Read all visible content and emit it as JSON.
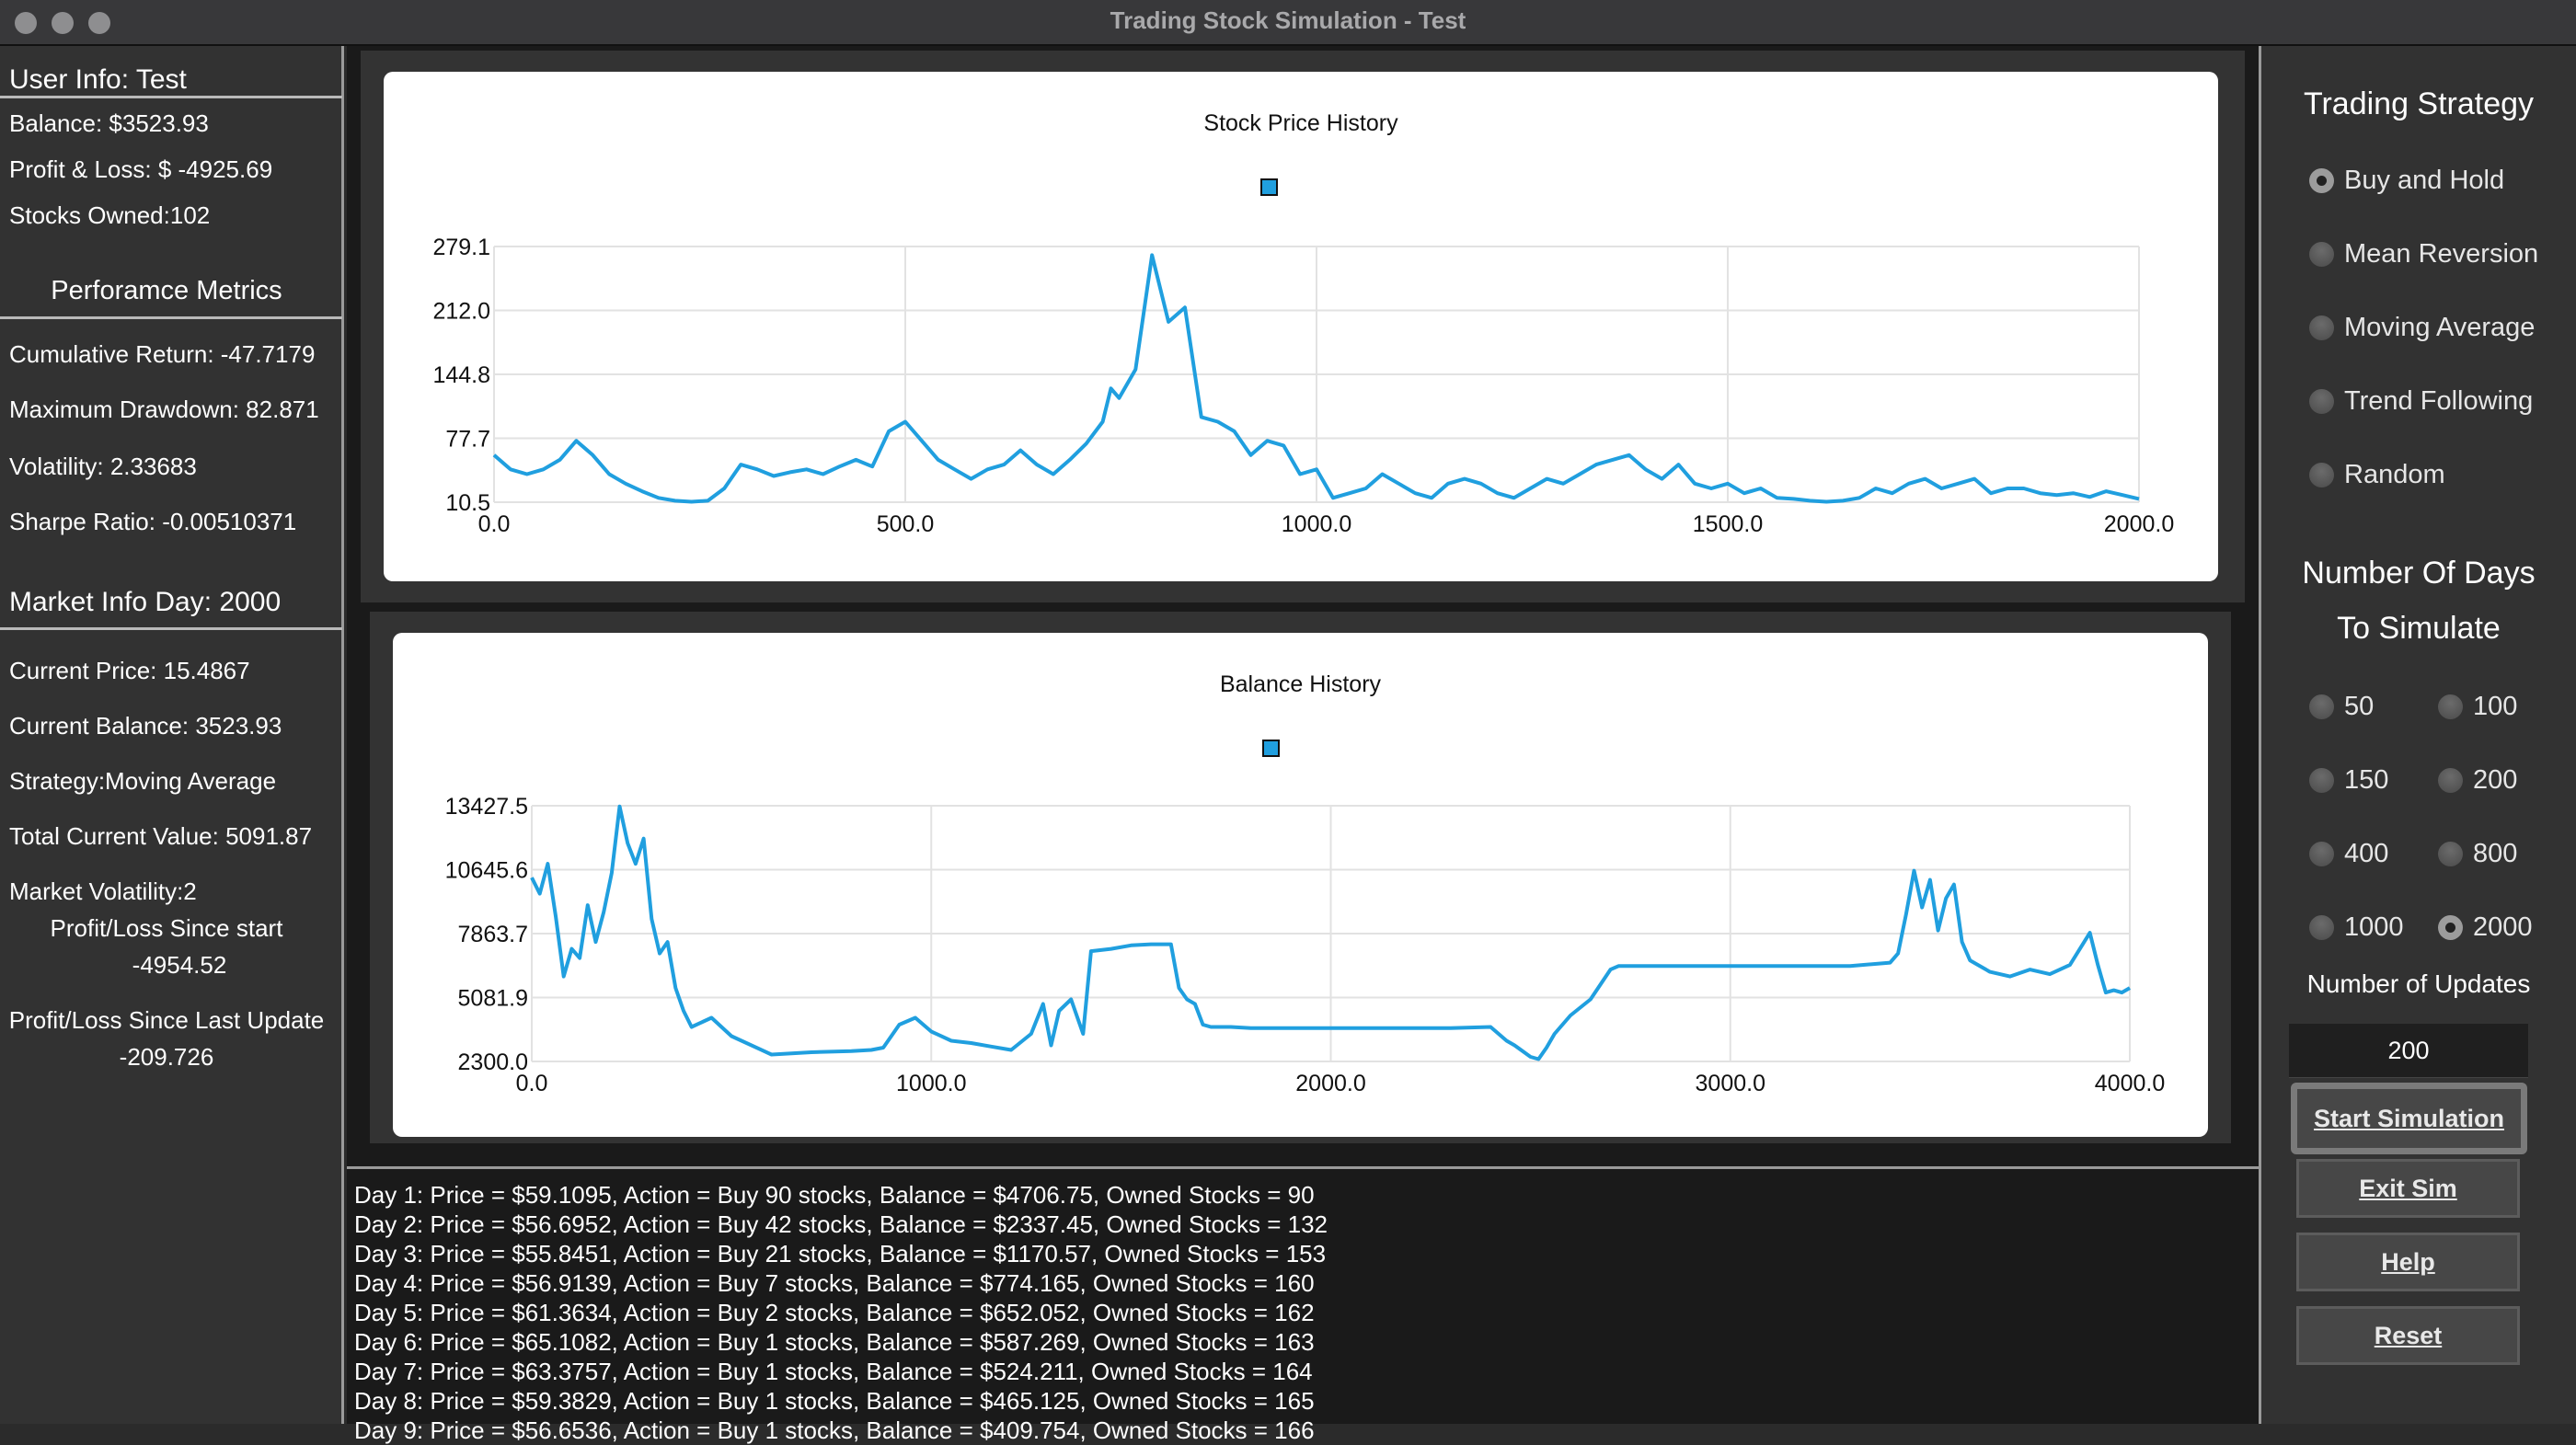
{
  "window": {
    "title": "Trading Stock Simulation - Test",
    "controls": [
      "close",
      "minimize",
      "zoom"
    ]
  },
  "user_info": {
    "heading": "User Info: Test",
    "balance": "Balance: $3523.93",
    "profit_loss": "Profit & Loss: $  -4925.69",
    "stocks_owned": "Stocks Owned:102"
  },
  "performance": {
    "heading": "Perforamce Metrics",
    "cumulative_return": "Cumulative Return: -47.7179",
    "max_drawdown": "Maximum Drawdown: 82.871",
    "volatility": "Volatility: 2.33683",
    "sharpe_ratio": "Sharpe Ratio: -0.00510371"
  },
  "market_info": {
    "heading": "Market Info Day: 2000",
    "current_price": "Current Price: 15.4867",
    "current_balance": "Current Balance:  3523.93",
    "strategy": "Strategy:Moving Average",
    "total_value": "Total Current Value: 5091.87",
    "market_volatility": "Market Volatility:2",
    "pl_since_start_label": "Profit/Loss Since start",
    "pl_since_start_value": "-4954.52",
    "pl_since_update_label": "Profit/Loss Since Last Update",
    "pl_since_update_value": "-209.726"
  },
  "chart_data": [
    {
      "type": "line",
      "title": "Stock Price History",
      "xlabel": "",
      "ylabel": "",
      "xlim": [
        0,
        2000
      ],
      "ylim": [
        10.5,
        279.1
      ],
      "x_ticks": [
        "0.0",
        "500.0",
        "1000.0",
        "1500.0",
        "2000.0"
      ],
      "y_ticks": [
        "10.5",
        "77.7",
        "144.8",
        "212.0",
        "279.1"
      ],
      "grid": true,
      "legend": "top-center",
      "series_color": "#209fdf",
      "series": [
        {
          "name": "",
          "x": [
            0,
            20,
            40,
            60,
            80,
            100,
            120,
            140,
            160,
            180,
            200,
            220,
            240,
            260,
            280,
            300,
            320,
            340,
            360,
            380,
            400,
            420,
            440,
            460,
            480,
            500,
            520,
            540,
            560,
            580,
            600,
            620,
            640,
            660,
            680,
            700,
            720,
            740,
            750,
            760,
            780,
            800,
            820,
            840,
            860,
            880,
            900,
            920,
            940,
            960,
            980,
            1000,
            1020,
            1040,
            1060,
            1080,
            1100,
            1120,
            1140,
            1160,
            1180,
            1200,
            1220,
            1240,
            1260,
            1280,
            1300,
            1320,
            1340,
            1360,
            1380,
            1400,
            1420,
            1440,
            1460,
            1480,
            1500,
            1520,
            1540,
            1560,
            1580,
            1600,
            1620,
            1640,
            1660,
            1680,
            1700,
            1720,
            1740,
            1760,
            1780,
            1800,
            1820,
            1840,
            1860,
            1880,
            1900,
            1920,
            1940,
            1960,
            1980,
            2000
          ],
          "values": [
            60,
            45,
            40,
            45,
            55,
            75,
            60,
            40,
            30,
            22,
            15,
            12,
            11,
            12,
            25,
            50,
            45,
            38,
            42,
            45,
            40,
            48,
            55,
            48,
            85,
            95,
            75,
            55,
            45,
            35,
            45,
            50,
            65,
            50,
            40,
            55,
            72,
            95,
            130,
            120,
            150,
            270,
            200,
            215,
            100,
            95,
            85,
            60,
            75,
            70,
            40,
            45,
            15,
            20,
            25,
            40,
            30,
            20,
            15,
            30,
            35,
            30,
            20,
            15,
            25,
            35,
            30,
            40,
            50,
            55,
            60,
            45,
            35,
            50,
            30,
            25,
            30,
            20,
            25,
            15,
            14,
            12,
            11,
            12,
            15,
            25,
            20,
            30,
            35,
            25,
            30,
            35,
            20,
            25,
            25,
            20,
            18,
            20,
            16,
            22,
            18,
            14
          ]
        }
      ]
    },
    {
      "type": "line",
      "title": "Balance History",
      "xlabel": "",
      "ylabel": "",
      "xlim": [
        0,
        4000
      ],
      "ylim": [
        2300.0,
        13427.5
      ],
      "x_ticks": [
        "0.0",
        "1000.0",
        "2000.0",
        "3000.0",
        "4000.0"
      ],
      "y_ticks": [
        "2300.0",
        "5081.9",
        "7863.7",
        "10645.6",
        "13427.5"
      ],
      "grid": true,
      "legend": "top-center",
      "series_color": "#209fdf",
      "series": [
        {
          "name": "",
          "x": [
            0,
            20,
            40,
            60,
            80,
            100,
            120,
            140,
            160,
            180,
            200,
            220,
            240,
            260,
            280,
            300,
            320,
            340,
            360,
            380,
            400,
            450,
            500,
            600,
            700,
            800,
            850,
            880,
            920,
            960,
            1000,
            1050,
            1100,
            1150,
            1200,
            1250,
            1280,
            1300,
            1320,
            1350,
            1380,
            1400,
            1450,
            1500,
            1550,
            1600,
            1620,
            1640,
            1660,
            1680,
            1700,
            1750,
            1800,
            1900,
            2000,
            2100,
            2200,
            2300,
            2400,
            2440,
            2460,
            2500,
            2520,
            2540,
            2560,
            2600,
            2650,
            2700,
            2720,
            2760,
            2780,
            2800,
            2900,
            3000,
            3100,
            3200,
            3300,
            3400,
            3420,
            3440,
            3460,
            3480,
            3500,
            3520,
            3540,
            3560,
            3580,
            3600,
            3620,
            3650,
            3700,
            3750,
            3800,
            3850,
            3900,
            3920,
            3940,
            3960,
            3980,
            4000
          ],
          "values": [
            10300,
            9600,
            10900,
            8600,
            6000,
            7200,
            6800,
            9100,
            7500,
            8800,
            10500,
            13400,
            11800,
            10900,
            12000,
            8500,
            7000,
            7500,
            5500,
            4500,
            3800,
            4200,
            3400,
            2600,
            2700,
            2750,
            2800,
            2900,
            3900,
            4200,
            3600,
            3200,
            3100,
            2950,
            2800,
            3500,
            4800,
            3000,
            4500,
            5000,
            3500,
            7100,
            7200,
            7350,
            7400,
            7400,
            5500,
            5000,
            4800,
            3900,
            3800,
            3800,
            3750,
            3750,
            3750,
            3750,
            3750,
            3750,
            3800,
            3200,
            3000,
            2500,
            2400,
            2900,
            3500,
            4300,
            5000,
            6300,
            6450,
            6450,
            6450,
            6450,
            6450,
            6450,
            6450,
            6450,
            6450,
            6600,
            7000,
            8700,
            10600,
            9000,
            10200,
            8000,
            9400,
            10000,
            7500,
            6700,
            6500,
            6200,
            6000,
            6300,
            6100,
            6500,
            7900,
            6500,
            5300,
            5400,
            5300,
            5500
          ]
        }
      ]
    }
  ],
  "log": {
    "lines": [
      "Day 1: Price = $59.1095, Action = Buy 90 stocks, Balance = $4706.75, Owned Stocks = 90",
      "Day 2: Price = $56.6952, Action = Buy 42 stocks, Balance = $2337.45, Owned Stocks = 132",
      "Day 3: Price = $55.8451, Action = Buy 21 stocks, Balance = $1170.57, Owned Stocks = 153",
      "Day 4: Price = $56.9139, Action = Buy 7 stocks, Balance = $774.165, Owned Stocks = 160",
      "Day 5: Price = $61.3634, Action = Buy 2 stocks, Balance = $652.052, Owned Stocks = 162",
      "Day 6: Price = $65.1082, Action = Buy 1 stocks, Balance = $587.269, Owned Stocks = 163",
      "Day 7: Price = $63.3757, Action = Buy 1 stocks, Balance = $524.211, Owned Stocks = 164",
      "Day 8: Price = $59.3829, Action = Buy 1 stocks, Balance = $465.125, Owned Stocks = 165",
      "Day 9: Price = $56.6536, Action = Buy 1 stocks, Balance = $409.754, Owned Stocks = 166"
    ]
  },
  "strategy": {
    "heading": "Trading Strategy",
    "options": [
      {
        "label": "Buy and Hold",
        "checked": true
      },
      {
        "label": "Mean Reversion",
        "checked": false
      },
      {
        "label": "Moving Average",
        "checked": false
      },
      {
        "label": "Trend Following",
        "checked": false
      },
      {
        "label": "Random",
        "checked": false
      }
    ]
  },
  "days": {
    "heading_line1": "Number Of Days",
    "heading_line2": "To Simulate",
    "options": [
      {
        "label": "50",
        "checked": false
      },
      {
        "label": "100",
        "checked": false
      },
      {
        "label": "150",
        "checked": false
      },
      {
        "label": "200",
        "checked": false
      },
      {
        "label": "400",
        "checked": false
      },
      {
        "label": "800",
        "checked": false
      },
      {
        "label": "1000",
        "checked": false
      },
      {
        "label": "2000",
        "checked": true
      }
    ]
  },
  "updates": {
    "label": "Number of Updates",
    "value": "200"
  },
  "buttons": {
    "start": "Start Simulation",
    "exit": "Exit Sim",
    "help": "Help",
    "reset": "Reset"
  }
}
